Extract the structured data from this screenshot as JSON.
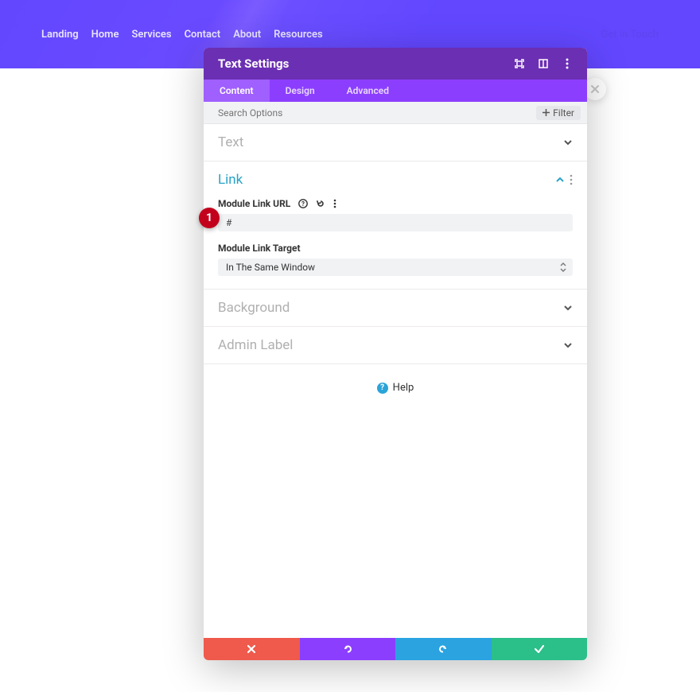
{
  "nav": {
    "items": [
      "Landing",
      "Home",
      "Services",
      "Contact",
      "About",
      "Resources"
    ],
    "cta": "Get in Touch"
  },
  "modal": {
    "title": "Text Settings",
    "tabs": [
      "Content",
      "Design",
      "Advanced"
    ],
    "search_placeholder": "Search Options",
    "filter_label": "Filter",
    "sections": {
      "text": "Text",
      "link": "Link",
      "background": "Background",
      "admin": "Admin Label"
    },
    "link": {
      "url_label": "Module Link URL",
      "url_value": "#",
      "target_label": "Module Link Target",
      "target_value": "In The Same Window"
    },
    "help": "Help"
  },
  "badge": "1"
}
